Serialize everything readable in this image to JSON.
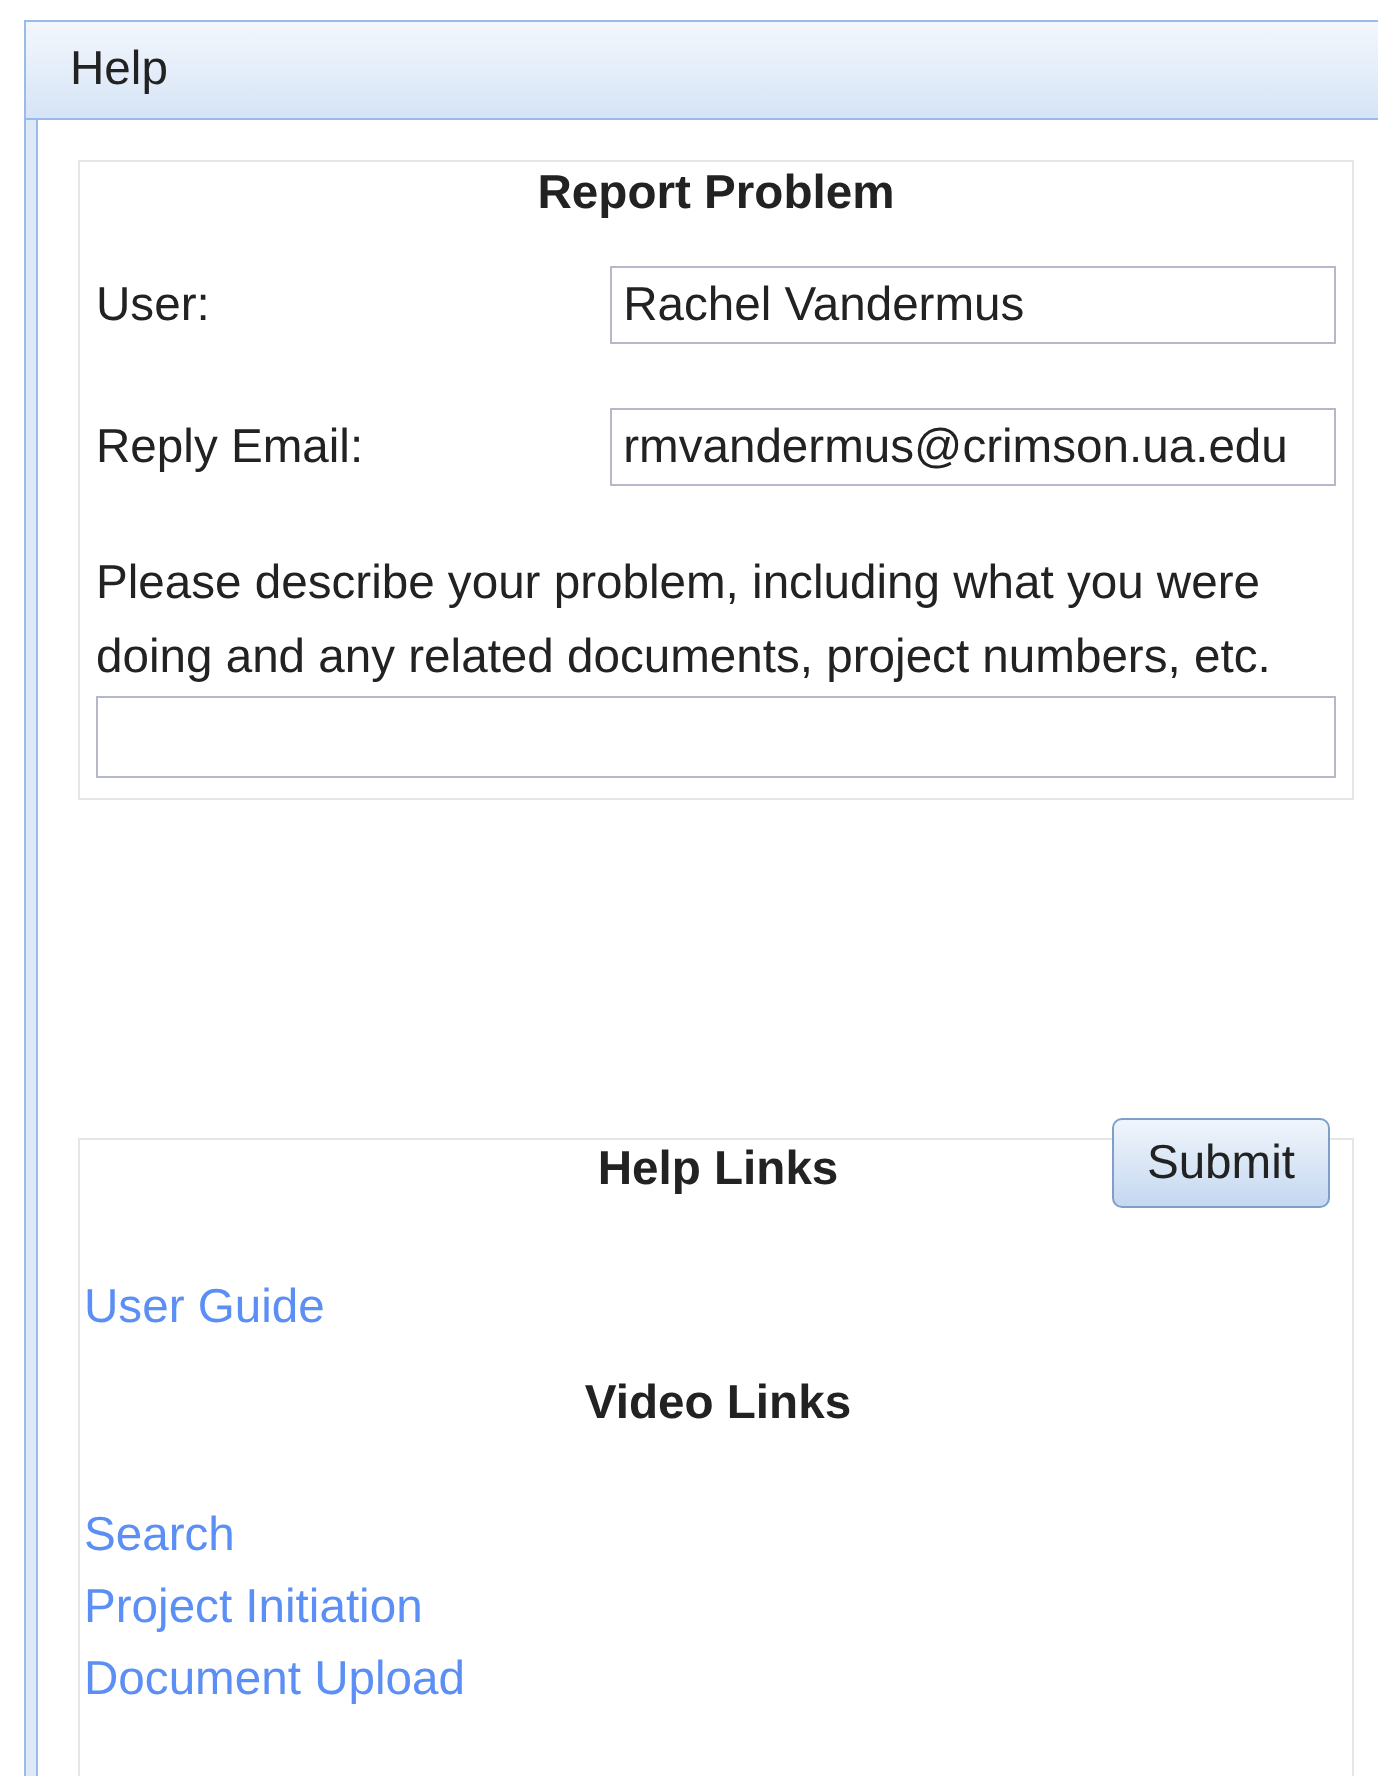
{
  "window": {
    "title": "Help"
  },
  "report_problem": {
    "heading": "Report Problem",
    "fields": [
      {
        "label": "User:",
        "value": "Rachel Vandermus"
      },
      {
        "label": "Reply Email:",
        "value": "rmvandermus@crimson.ua.edu"
      }
    ],
    "description": {
      "label": "Please describe your problem, including what you were doing and any related documents, project numbers, etc."
    },
    "submit": "Submit"
  },
  "help_links": {
    "heading": "Help Links",
    "links": [
      "User Guide"
    ]
  },
  "video_links": {
    "heading": "Video Links",
    "links": [
      "Search",
      "Project Initiation",
      "Document Upload"
    ]
  }
}
